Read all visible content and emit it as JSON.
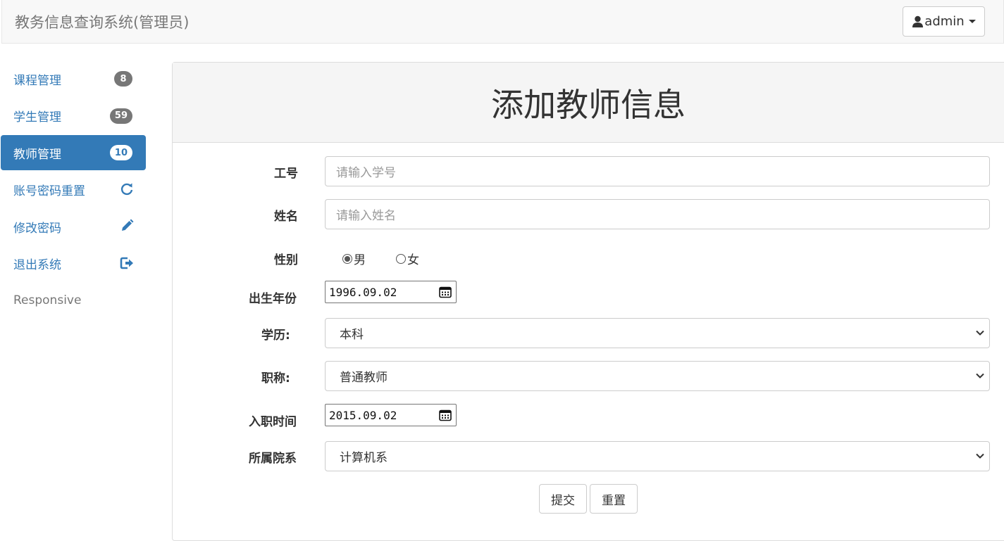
{
  "header": {
    "brand": "教务信息查询系统(管理员)",
    "user_label": "admin"
  },
  "sidebar": {
    "items": [
      {
        "label": "课程管理",
        "badge": "8"
      },
      {
        "label": "学生管理",
        "badge": "59"
      },
      {
        "label": "教师管理",
        "badge": "10"
      },
      {
        "label": "账号密码重置",
        "icon": "refresh-icon"
      },
      {
        "label": "修改密码",
        "icon": "pencil-icon"
      },
      {
        "label": "退出系统",
        "icon": "logout-icon"
      }
    ],
    "footer": "Responsive",
    "active_index": 2
  },
  "form": {
    "title": "添加教师信息",
    "id_label": "工号",
    "id_placeholder": "请输入学号",
    "name_label": "姓名",
    "name_placeholder": "请输入姓名",
    "gender_label": "性别",
    "gender_options": [
      "男",
      "女"
    ],
    "gender_selected": "男",
    "birth_label": "出生年份",
    "birth_value": "1996.09.02",
    "degree_label": "学历:",
    "degree_value": "本科",
    "title_label": "职称:",
    "title_value": "普通教师",
    "hire_label": "入职时间",
    "hire_value": "2015.09.02",
    "dept_label": "所属院系",
    "dept_value": "计算机系",
    "submit_label": "提交",
    "reset_label": "重置"
  },
  "colors": {
    "accent": "#337ab7",
    "badge": "#777777",
    "navbar_bg": "#f8f8f8",
    "panel_heading_bg": "#f5f5f5"
  }
}
